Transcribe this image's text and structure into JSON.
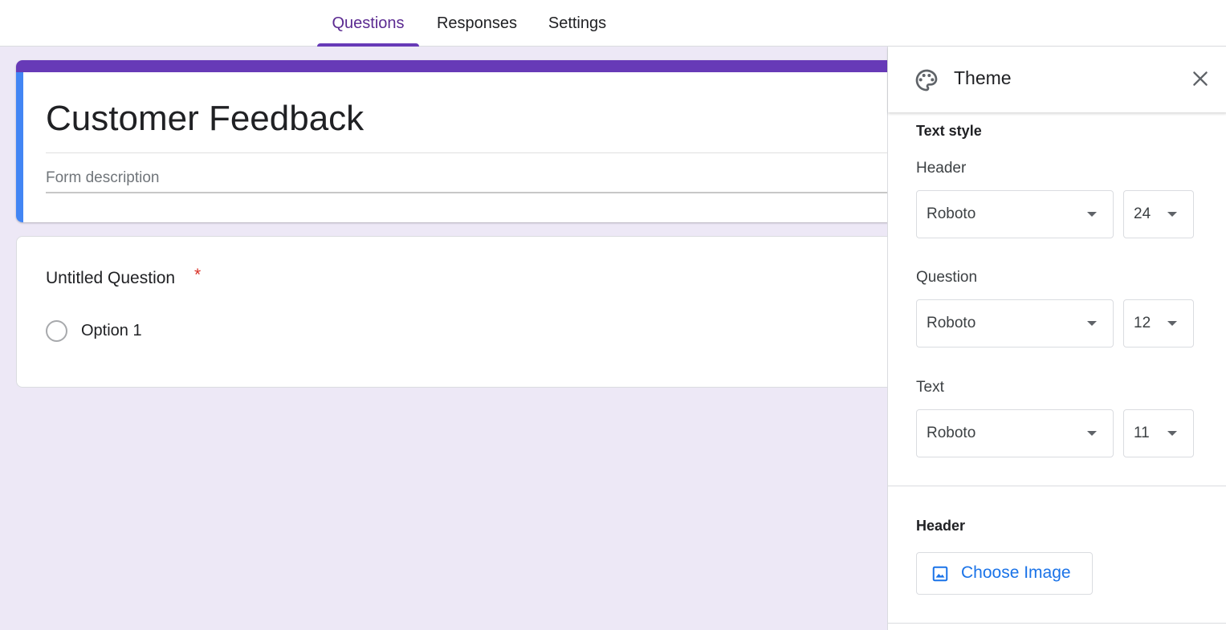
{
  "tabs": [
    {
      "label": "Questions",
      "active": true
    },
    {
      "label": "Responses",
      "active": false
    },
    {
      "label": "Settings",
      "active": false
    }
  ],
  "form": {
    "title": "Customer Feedback",
    "description_placeholder": "Form description"
  },
  "question": {
    "title": "Untitled Question",
    "required_mark": "*",
    "options": [
      "Option 1"
    ]
  },
  "theme_panel": {
    "title": "Theme",
    "text_style": {
      "section_label": "Text style",
      "header": {
        "label": "Header",
        "font": "Roboto",
        "size": "24"
      },
      "question": {
        "label": "Question",
        "font": "Roboto",
        "size": "12"
      },
      "text": {
        "label": "Text",
        "font": "Roboto",
        "size": "11"
      }
    },
    "header_section": {
      "section_label": "Header",
      "choose_image_label": "Choose Image"
    }
  },
  "colors": {
    "accent": "#673ab7",
    "left_stripe": "#4285f4",
    "background": "#ede8f6",
    "link_blue": "#1a73e8",
    "required_red": "#d93025"
  },
  "icons": {
    "panel": "palette-icon",
    "close": "close-icon",
    "choose_image": "image-icon",
    "dropdown": "dropdown-caret-icon"
  }
}
